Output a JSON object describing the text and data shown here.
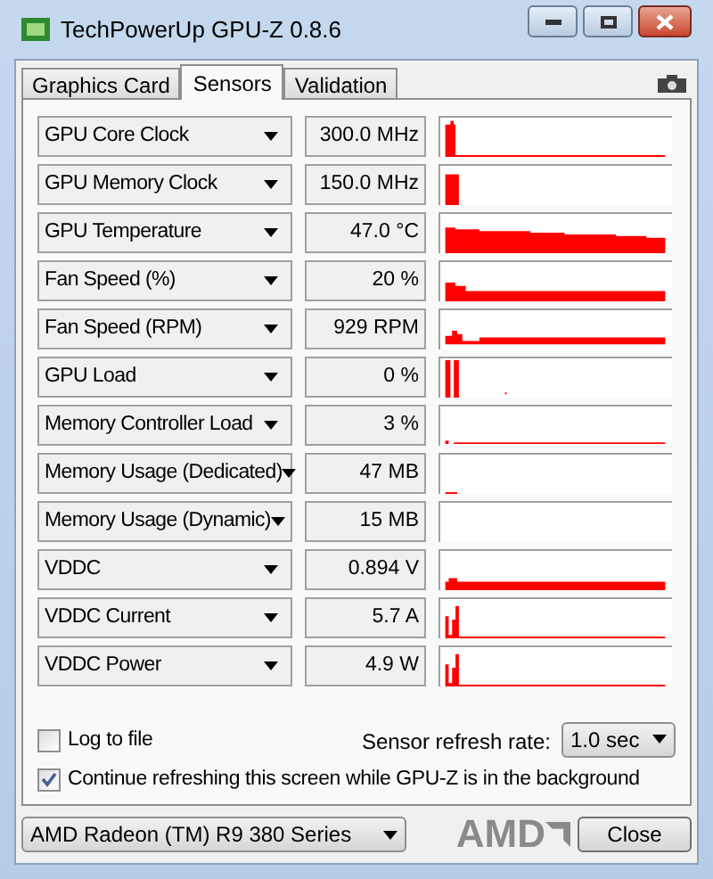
{
  "window": {
    "title": "TechPowerUp GPU-Z 0.8.6"
  },
  "tabs": [
    {
      "label": "Graphics Card",
      "selected": false
    },
    {
      "label": "Sensors",
      "selected": true
    },
    {
      "label": "Validation",
      "selected": false
    }
  ],
  "sensors": [
    {
      "name": "GPU Core Clock",
      "reading": "300.0 MHz"
    },
    {
      "name": "GPU Memory Clock",
      "reading": "150.0 MHz"
    },
    {
      "name": "GPU Temperature",
      "reading": "47.0 °C"
    },
    {
      "name": "Fan Speed (%)",
      "reading": "20 %"
    },
    {
      "name": "Fan Speed (RPM)",
      "reading": "929 RPM"
    },
    {
      "name": "GPU Load",
      "reading": "0 %"
    },
    {
      "name": "Memory Controller Load",
      "reading": "3 %"
    },
    {
      "name": "Memory Usage (Dedicated)",
      "reading": "47 MB"
    },
    {
      "name": "Memory Usage (Dynamic)",
      "reading": "15 MB"
    },
    {
      "name": "VDDC",
      "reading": "0.894 V"
    },
    {
      "name": "VDDC Current",
      "reading": "5.7 A"
    },
    {
      "name": "VDDC Power",
      "reading": "4.9 W"
    }
  ],
  "log_to_file": {
    "label": "Log to file",
    "checked": false
  },
  "refresh_rate": {
    "label": "Sensor refresh rate:",
    "value": "1.0 sec"
  },
  "continue_refreshing": {
    "label": "Continue refreshing this screen while GPU-Z is in the background",
    "checked": true
  },
  "gpu_select": {
    "value": "AMD Radeon (TM) R9 380 Series"
  },
  "logo": {
    "text": "AMD"
  },
  "buttons": [
    "Close"
  ]
}
